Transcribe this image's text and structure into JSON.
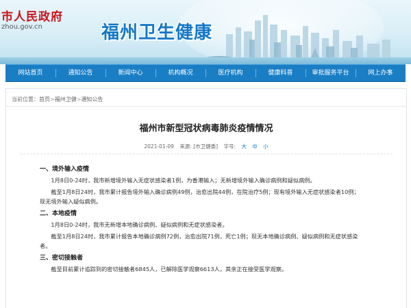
{
  "header": {
    "gov_name": "市人民政府",
    "gov_domain": "zhou.gov.cn",
    "site_title": "福州卫生健康"
  },
  "nav": {
    "items": [
      "网站首页",
      "通知公告",
      "新闻中心",
      "机构概况",
      "医疗机构",
      "健康科普",
      "审批服务平台",
      "网上办事"
    ]
  },
  "breadcrumb": {
    "label": "当前位置：",
    "items": [
      "首页",
      "福州卫健",
      "通知公告"
    ],
    "separator": ">"
  },
  "article": {
    "title": "福州市新型冠状病毒肺炎疫情情况",
    "date": "2021-01-09",
    "source": "来源: [市卫健委]",
    "font_label": "字号:",
    "font_large": "大",
    "font_medium": "中",
    "font_small": "小",
    "sections": [
      {
        "heading": "一、境外输入疫情",
        "paragraphs": [
          "1月8日0-24时，我市新增境外输入无症状感染者1例，为香港输入；无新增境外输入确诊病例和疑似病例。",
          "截至1月8日24时，我市累计报告境外输入确诊病例49例，治愈出院44例，在院治疗5例；现有境外输入无症状感染者10例；现无境外输入疑似病例。"
        ]
      },
      {
        "heading": "二、本地疫情",
        "paragraphs": [
          "1月8日0-24时，我市无新增本地确诊病例、疑似病例和无症状感染者。",
          "截至1月8日24时，我市累计报告本地确诊病例72例，治愈出院71例，死亡1例；现无本地确诊病例、疑似病例和无症状感染者。"
        ]
      },
      {
        "heading": "三、密切接触者",
        "paragraphs": [
          "截至目前累计追踪到的密切接触者6845人，已解除医学观察6613人，其余正在接受医学观察。"
        ]
      }
    ]
  }
}
